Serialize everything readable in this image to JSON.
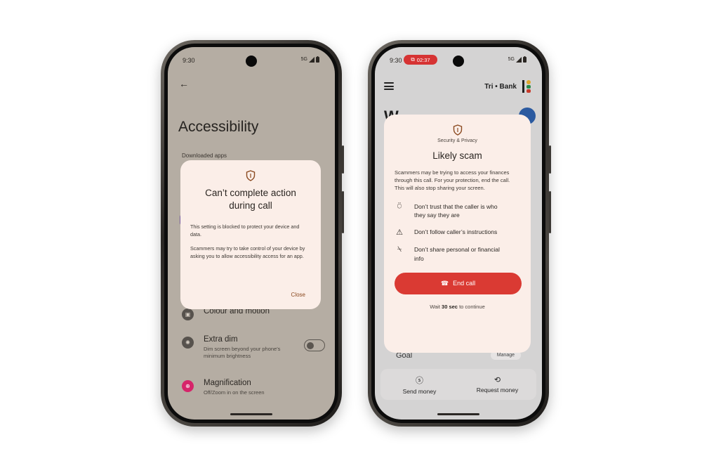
{
  "left_phone": {
    "status": {
      "time": "9:30",
      "network": "5G"
    },
    "back_icon": "arrow-left-icon",
    "title": "Accessibility",
    "section_label": "Downloaded apps",
    "rows": [
      {
        "icon": "palette-icon",
        "title": "Colour and motion",
        "subtitle": ""
      },
      {
        "icon": "extra-dim-icon",
        "title": "Extra dim",
        "subtitle_line1": "Dim screen beyond your phone's",
        "subtitle_line2": "minimum brightness"
      },
      {
        "icon": "magnification-icon",
        "title": "Magnification",
        "subtitle": "Off/Zoom in on the screen"
      }
    ],
    "dialog": {
      "icon": "shield-icon",
      "title_line1": "Can’t complete action",
      "title_line2": "during call",
      "body1": "This setting is blocked to protect your device and data.",
      "body2": "Scammers may try to take control of your device by asking you to allow accessibility access for an app.",
      "close_label": "Close"
    }
  },
  "right_phone": {
    "status": {
      "time": "9:30",
      "call_timer": "02:37",
      "network": "5G"
    },
    "bank_name": "Tri • Bank",
    "welcome_fragment": "W",
    "goal_label": "Goal",
    "manage_label": "Manage",
    "nav": [
      {
        "icon": "dollar-icon",
        "label": "Send money"
      },
      {
        "icon": "request-money-icon",
        "label": "Request money"
      }
    ],
    "dialog": {
      "icon": "shield-icon",
      "category": "Security & Privacy",
      "title": "Likely scam",
      "body": "Scammers may be trying to access your finances through this call. For your protection, end the call. This will also stop sharing your screen.",
      "tips": [
        {
          "icon": "no-trust-icon",
          "line1": "Don’t trust that the caller is who",
          "line2": "they say they are"
        },
        {
          "icon": "warning-icon",
          "line1": "Don’t follow caller’s instructions",
          "line2": ""
        },
        {
          "icon": "no-share-icon",
          "line1": "Don’t share personal or financial",
          "line2": "info"
        }
      ],
      "end_call_label": "End call",
      "wait_prefix": "Wait",
      "wait_time": "30 sec",
      "wait_suffix": "to continue"
    }
  }
}
